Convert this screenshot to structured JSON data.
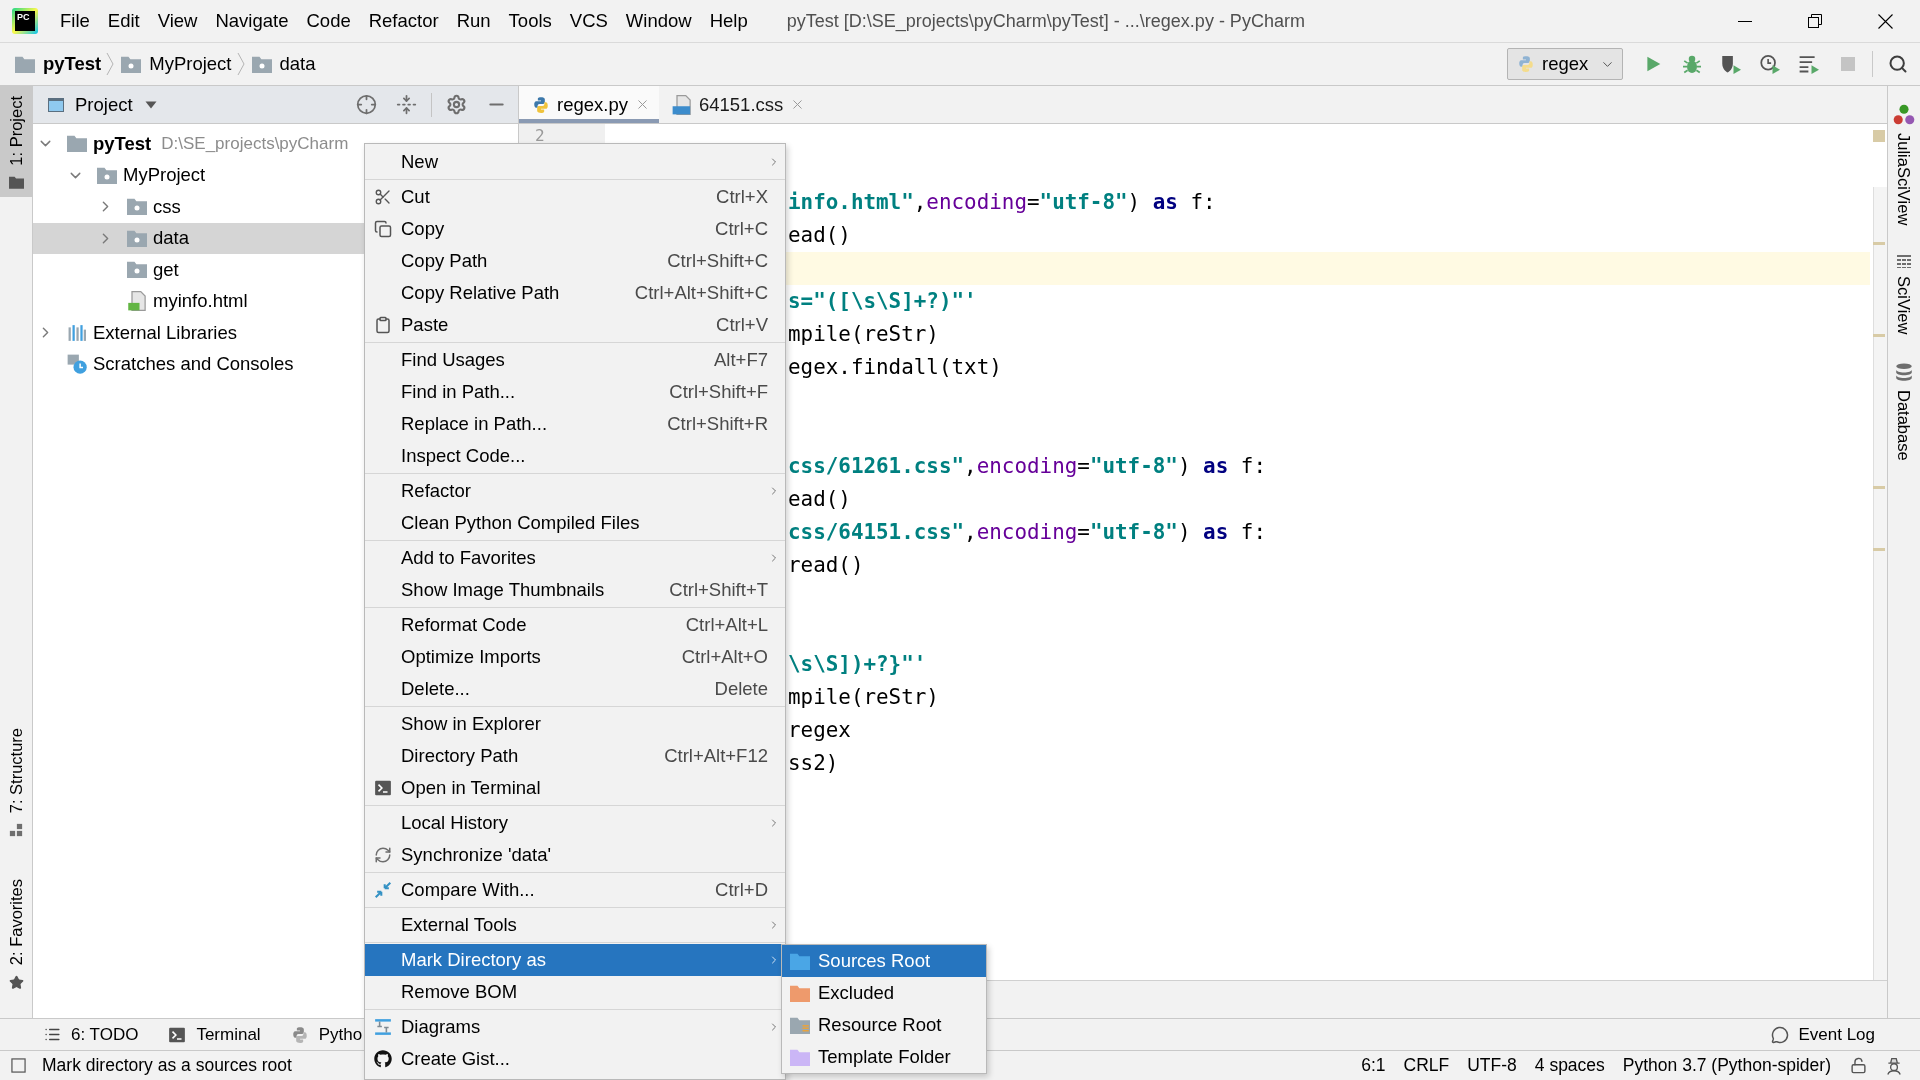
{
  "window": {
    "logo": "PC",
    "title": "pyTest [D:\\SE_projects\\pyCharm\\pyTest] - ...\\regex.py - PyCharm"
  },
  "menu_bar": [
    "File",
    "Edit",
    "View",
    "Navigate",
    "Code",
    "Refactor",
    "Run",
    "Tools",
    "VCS",
    "Window",
    "Help"
  ],
  "breadcrumbs": [
    "pyTest",
    "MyProject",
    "data"
  ],
  "run_config": {
    "label": "regex"
  },
  "left_stripe": [
    {
      "label": "1: Project",
      "selected": true
    },
    {
      "label": "7: Structure",
      "selected": false
    },
    {
      "label": "2: Favorites",
      "selected": false
    }
  ],
  "project_panel": {
    "title": "Project",
    "tree": [
      {
        "label": "pyTest",
        "kind": "project",
        "path": "D:\\SE_projects\\pyCharm",
        "expanded": true,
        "selected": false,
        "children": [
          {
            "label": "MyProject",
            "kind": "folder",
            "expanded": true,
            "selected": false,
            "children": [
              {
                "label": "css",
                "kind": "folder",
                "expanded": false,
                "selected": false
              },
              {
                "label": "data",
                "kind": "folder",
                "expanded": false,
                "selected": true
              },
              {
                "label": "get",
                "kind": "folder",
                "selected": false
              },
              {
                "label": "myinfo.html",
                "kind": "html",
                "selected": false
              }
            ]
          }
        ]
      },
      {
        "label": "External Libraries",
        "kind": "libraries",
        "expanded": false,
        "selected": false
      },
      {
        "label": "Scratches and Consoles",
        "kind": "scratches",
        "selected": false
      }
    ]
  },
  "editor_tabs": [
    {
      "label": "regex.py",
      "kind": "python",
      "selected": true
    },
    {
      "label": "64151.css",
      "kind": "css",
      "selected": false
    }
  ],
  "editor": {
    "line_number": "2",
    "lines": [
      {
        "current": false
      },
      {
        "current": false
      },
      {
        "current": false,
        "tokens": [
          {
            "kind": "string",
            "text": "info.html\""
          },
          {
            "kind": "plain",
            "text": ","
          },
          {
            "kind": "param",
            "text": "encoding"
          },
          {
            "kind": "plain",
            "text": "="
          },
          {
            "kind": "string",
            "text": "\"utf-8\""
          },
          {
            "kind": "plain",
            "text": ") "
          },
          {
            "kind": "keyword",
            "text": "as"
          },
          {
            "kind": "plain",
            "text": " f:"
          }
        ]
      },
      {
        "current": false,
        "tokens": [
          {
            "kind": "plain",
            "text": "ead()"
          }
        ]
      },
      {
        "current": true
      },
      {
        "current": false,
        "tokens": [
          {
            "kind": "string",
            "text": "s=\"([\\s\\S]+?)\"'"
          }
        ]
      },
      {
        "current": false,
        "tokens": [
          {
            "kind": "plain",
            "text": "mpile(reStr)"
          }
        ]
      },
      {
        "current": false,
        "tokens": [
          {
            "kind": "plain",
            "text": "egex.findall(txt)"
          }
        ]
      },
      {
        "current": false
      },
      {
        "current": false
      },
      {
        "current": false,
        "tokens": [
          {
            "kind": "string",
            "text": "css/61261.css\""
          },
          {
            "kind": "plain",
            "text": ","
          },
          {
            "kind": "param",
            "text": "encoding"
          },
          {
            "kind": "plain",
            "text": "="
          },
          {
            "kind": "string",
            "text": "\"utf-8\""
          },
          {
            "kind": "plain",
            "text": ") "
          },
          {
            "kind": "keyword",
            "text": "as"
          },
          {
            "kind": "plain",
            "text": " f:"
          }
        ]
      },
      {
        "current": false,
        "tokens": [
          {
            "kind": "plain",
            "text": "ead()"
          }
        ]
      },
      {
        "current": false,
        "tokens": [
          {
            "kind": "string",
            "text": "css/64151.css\""
          },
          {
            "kind": "plain",
            "text": ","
          },
          {
            "kind": "param",
            "text": "encoding"
          },
          {
            "kind": "plain",
            "text": "="
          },
          {
            "kind": "string",
            "text": "\"utf-8\""
          },
          {
            "kind": "plain",
            "text": ") "
          },
          {
            "kind": "keyword",
            "text": "as"
          },
          {
            "kind": "plain",
            "text": " f:"
          }
        ]
      },
      {
        "current": false,
        "tokens": [
          {
            "kind": "plain",
            "text": "read()"
          }
        ]
      },
      {
        "current": false
      },
      {
        "current": false
      },
      {
        "current": false,
        "tokens": [
          {
            "kind": "string",
            "text": "\\s\\S])+?}\"'"
          }
        ]
      },
      {
        "current": false,
        "tokens": [
          {
            "kind": "plain",
            "text": "mpile(reStr)"
          }
        ]
      },
      {
        "current": false,
        "tokens": [
          {
            "kind": "plain",
            "text": "regex"
          }
        ]
      },
      {
        "current": false,
        "tokens": [
          {
            "kind": "plain",
            "text": "ss2)"
          }
        ]
      }
    ]
  },
  "right_stripe": [
    "JuliaSciView",
    "SciView",
    "Database"
  ],
  "context_menu": {
    "groups": [
      [
        {
          "label": "New",
          "submenu": true,
          "selected": false
        }
      ],
      [
        {
          "label": "Cut",
          "shortcut": "Ctrl+X",
          "submenu": false,
          "selected": false
        },
        {
          "label": "Copy",
          "shortcut": "Ctrl+C",
          "submenu": false,
          "selected": false
        },
        {
          "label": "Copy Path",
          "shortcut": "Ctrl+Shift+C",
          "submenu": false,
          "selected": false
        },
        {
          "label": "Copy Relative Path",
          "shortcut": "Ctrl+Alt+Shift+C",
          "submenu": false,
          "selected": false
        },
        {
          "label": "Paste",
          "shortcut": "Ctrl+V",
          "submenu": false,
          "selected": false
        }
      ],
      [
        {
          "label": "Find Usages",
          "shortcut": "Alt+F7",
          "submenu": false,
          "selected": false
        },
        {
          "label": "Find in Path...",
          "shortcut": "Ctrl+Shift+F",
          "submenu": false,
          "selected": false
        },
        {
          "label": "Replace in Path...",
          "shortcut": "Ctrl+Shift+R",
          "submenu": false,
          "selected": false
        },
        {
          "label": "Inspect Code...",
          "submenu": false,
          "selected": false
        }
      ],
      [
        {
          "label": "Refactor",
          "submenu": true,
          "selected": false
        },
        {
          "label": "Clean Python Compiled Files",
          "submenu": false,
          "selected": false
        }
      ],
      [
        {
          "label": "Add to Favorites",
          "submenu": true,
          "selected": false
        },
        {
          "label": "Show Image Thumbnails",
          "shortcut": "Ctrl+Shift+T",
          "submenu": false,
          "selected": false
        }
      ],
      [
        {
          "label": "Reformat Code",
          "shortcut": "Ctrl+Alt+L",
          "submenu": false,
          "selected": false
        },
        {
          "label": "Optimize Imports",
          "shortcut": "Ctrl+Alt+O",
          "submenu": false,
          "selected": false
        },
        {
          "label": "Delete...",
          "shortcut": "Delete",
          "submenu": false,
          "selected": false
        }
      ],
      [
        {
          "label": "Show in Explorer",
          "submenu": false,
          "selected": false
        },
        {
          "label": "Directory Path",
          "shortcut": "Ctrl+Alt+F12",
          "submenu": false,
          "selected": false
        },
        {
          "label": "Open in Terminal",
          "submenu": false,
          "selected": false
        }
      ],
      [
        {
          "label": "Local History",
          "submenu": true,
          "selected": false
        },
        {
          "label": "Synchronize 'data'",
          "submenu": false,
          "selected": false
        }
      ],
      [
        {
          "label": "Compare With...",
          "shortcut": "Ctrl+D",
          "submenu": false,
          "selected": false
        }
      ],
      [
        {
          "label": "External Tools",
          "submenu": true,
          "selected": false
        }
      ],
      [
        {
          "label": "Mark Directory as",
          "submenu": true,
          "selected": true
        },
        {
          "label": "Remove BOM",
          "submenu": false,
          "selected": false
        }
      ],
      [
        {
          "label": "Diagrams",
          "submenu": true,
          "selected": false
        },
        {
          "label": "Create Gist...",
          "submenu": false,
          "selected": false
        }
      ]
    ]
  },
  "submenu": [
    {
      "label": "Sources Root",
      "kind": "sources",
      "selected": true
    },
    {
      "label": "Excluded",
      "kind": "excluded",
      "selected": false
    },
    {
      "label": "Resource Root",
      "kind": "resource",
      "selected": false
    },
    {
      "label": "Template Folder",
      "kind": "template",
      "selected": false
    }
  ],
  "bottom_tools": [
    "6: TODO",
    "Terminal",
    "Pytho"
  ],
  "event_log": "Event Log",
  "status_bar": {
    "message": "Mark directory as a sources root",
    "items": [
      "6:1",
      "CRLF",
      "UTF-8",
      "4 spaces",
      "Python 3.7 (Python-spider)"
    ]
  }
}
